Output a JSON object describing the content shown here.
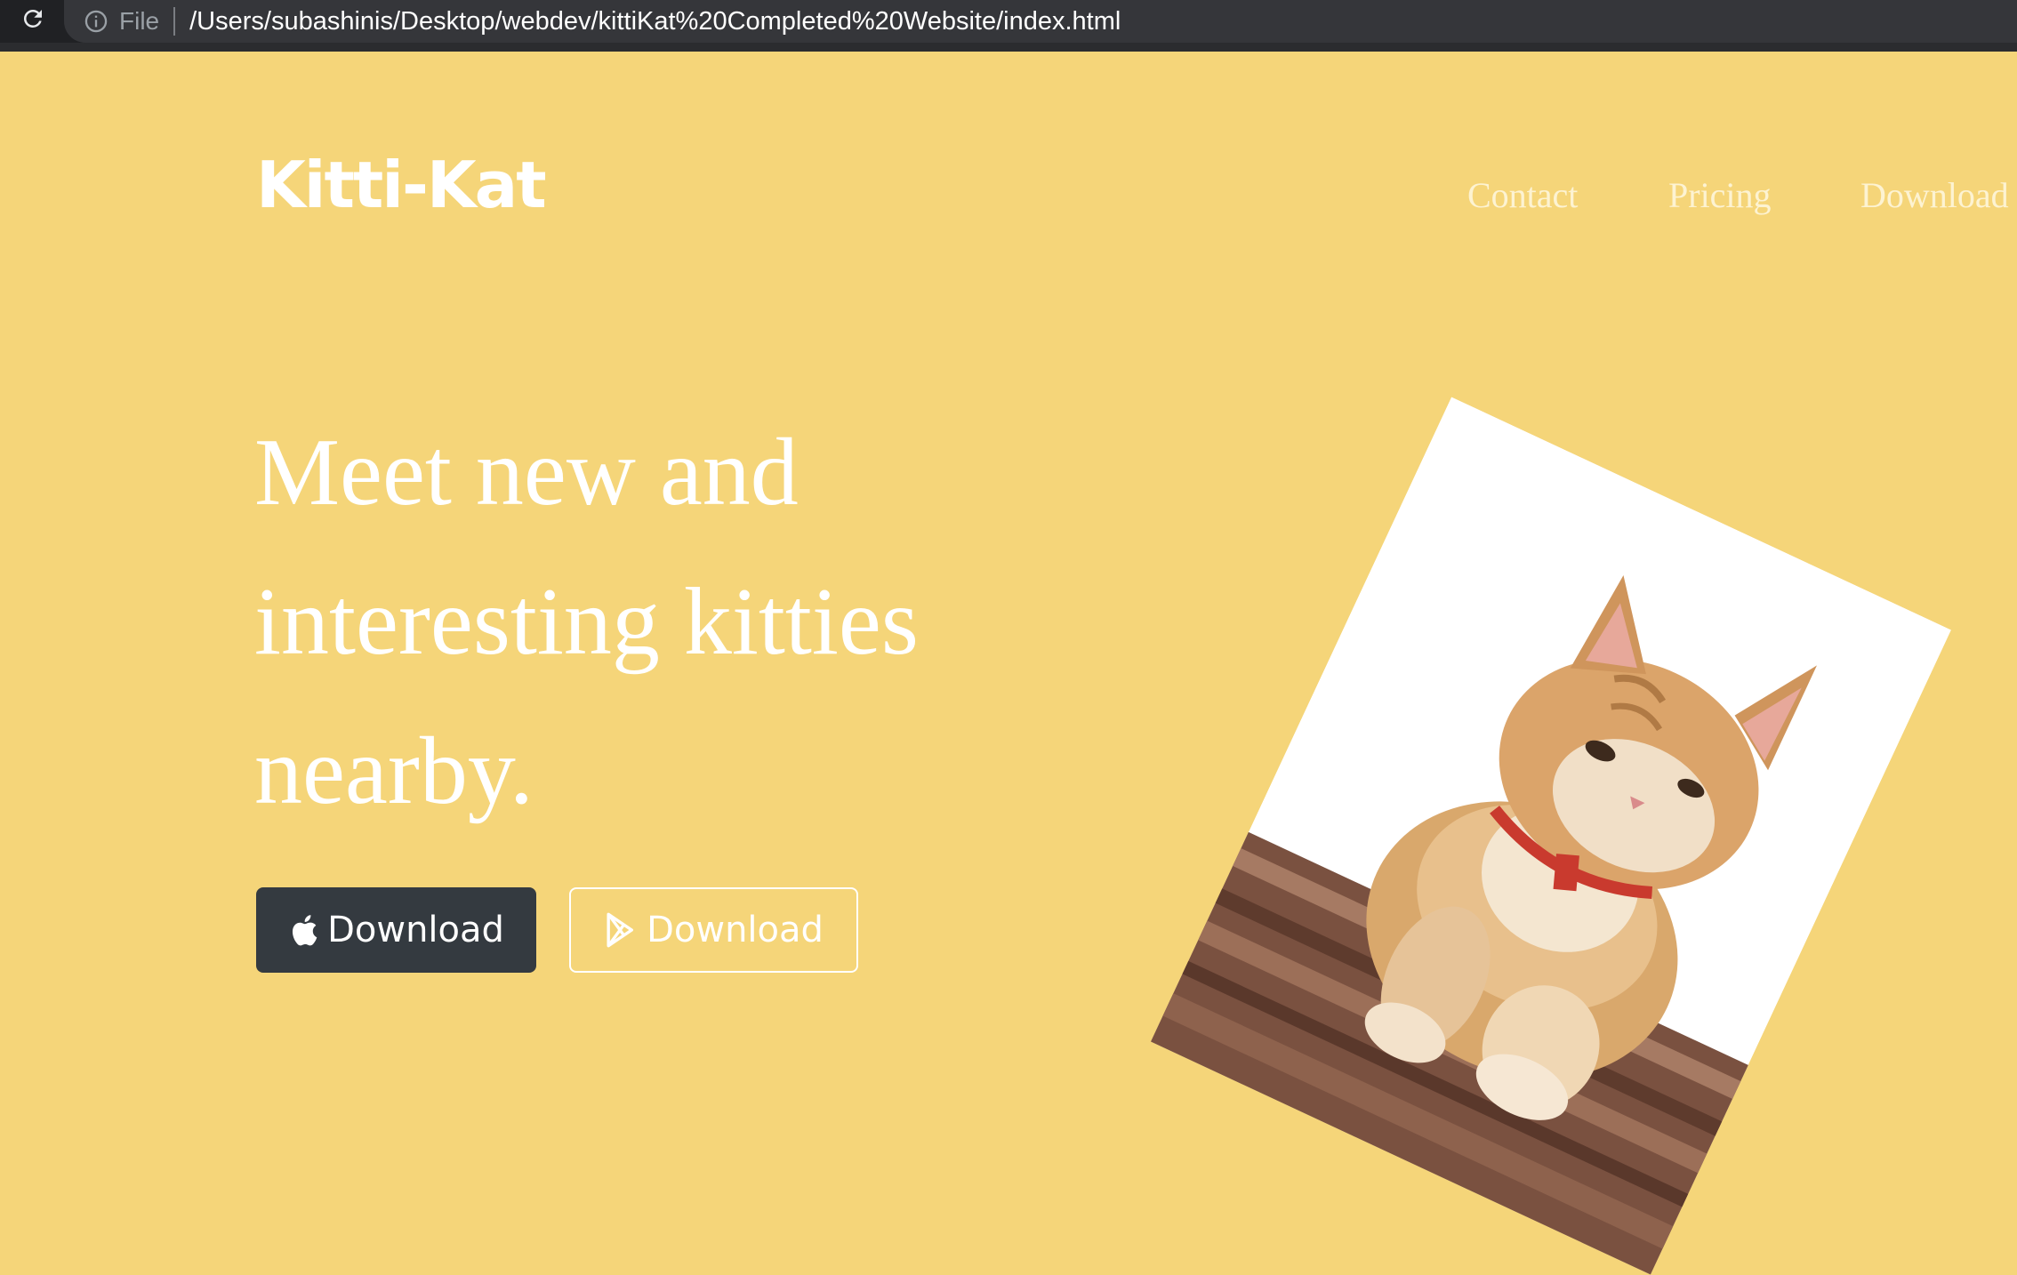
{
  "browser": {
    "file_label": "File",
    "url": "/Users/subashinis/Desktop/webdev/kittiKat%20Completed%20Website/index.html"
  },
  "brand": "Kitti-Kat",
  "nav": {
    "items": [
      {
        "label": "Contact"
      },
      {
        "label": "Pricing"
      },
      {
        "label": "Download"
      }
    ]
  },
  "hero": {
    "headline": "Meet new and interesting kitties nearby.",
    "buttons": {
      "apple_download": "Download",
      "play_download": "Download"
    }
  },
  "colors": {
    "page_background": "#f5d579",
    "dark_button": "#343a40",
    "text": "#ffffff"
  },
  "icons": [
    "reload-icon",
    "info-icon",
    "apple-icon",
    "google-play-icon"
  ]
}
